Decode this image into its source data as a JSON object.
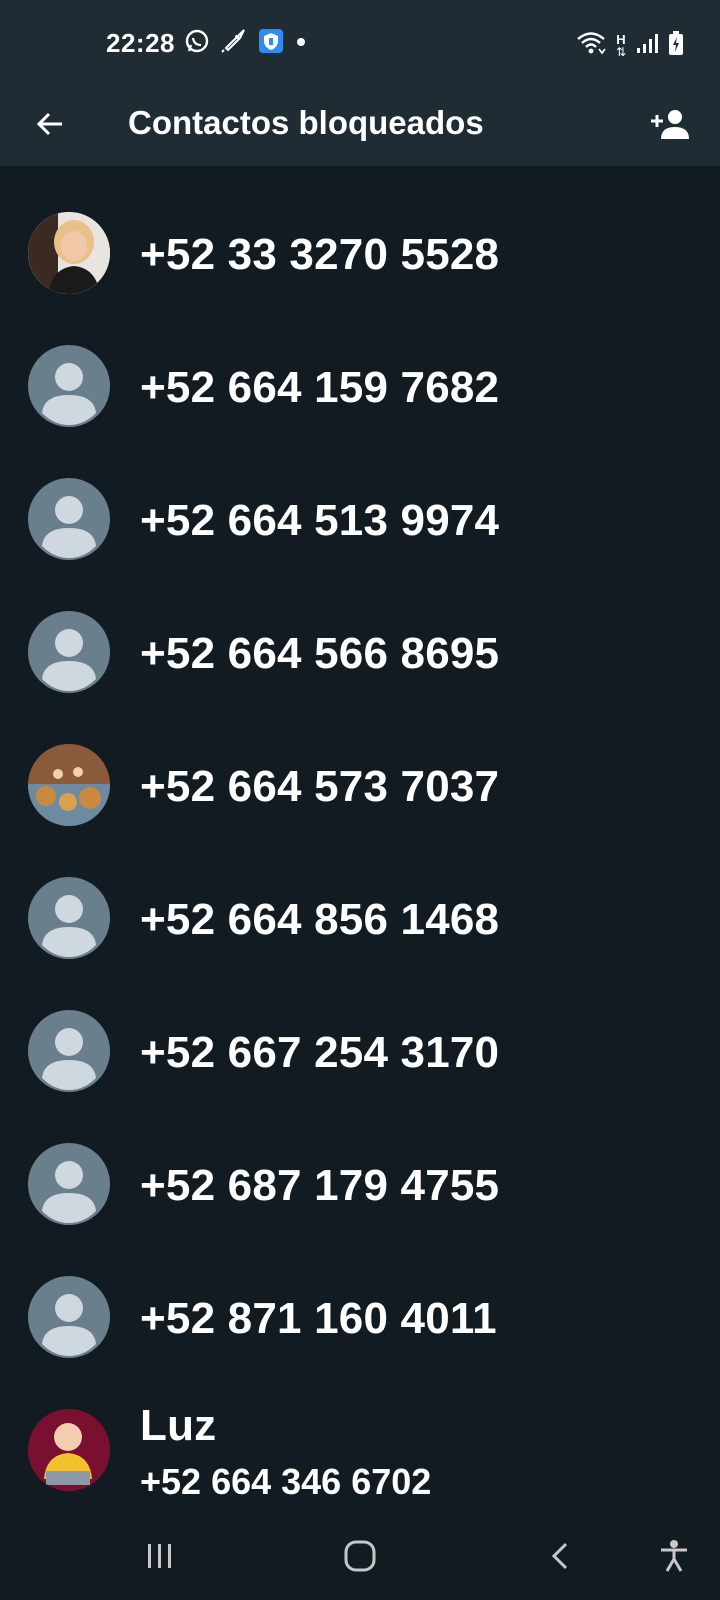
{
  "status_bar": {
    "time": "22:28",
    "left_icons": [
      "whatsapp-icon",
      "rocket-icon",
      "shield-app-icon",
      "dot-icon"
    ],
    "right_icons": [
      "wifi-icon",
      "h-data-icon",
      "signal-icon",
      "battery-icon"
    ],
    "h_label": "H"
  },
  "header": {
    "title": "Contactos bloqueados",
    "back_icon": "arrow-left-icon",
    "add_icon": "person-add-icon"
  },
  "contacts": [
    {
      "title": "+52 33 3270 5528",
      "avatar": "photo-woman"
    },
    {
      "title": "+52 664 159 7682",
      "avatar": "default"
    },
    {
      "title": "+52 664 513 9974",
      "avatar": "default"
    },
    {
      "title": "+52 664 566 8695",
      "avatar": "default"
    },
    {
      "title": "+52 664 573 7037",
      "avatar": "photo-group"
    },
    {
      "title": "+52 664 856 1468",
      "avatar": "default"
    },
    {
      "title": "+52 667 254 3170",
      "avatar": "default"
    },
    {
      "title": "+52 687 179 4755",
      "avatar": "default"
    },
    {
      "title": "+52 871 160 4011",
      "avatar": "default"
    },
    {
      "title": "Luz",
      "subtitle": "+52 664 346 6702",
      "avatar": "photo-baby"
    }
  ],
  "nav": {
    "icons": [
      "recents-icon",
      "home-icon",
      "back-icon",
      "accessibility-icon"
    ]
  },
  "colors": {
    "background": "#121b22",
    "bar": "#1f2c34",
    "avatar_default": "#6a7f8c",
    "text": "#ffffff"
  }
}
